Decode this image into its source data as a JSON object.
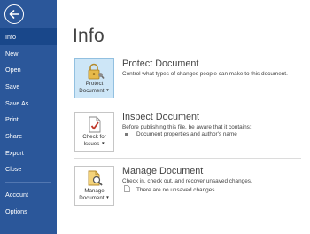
{
  "nav": {
    "items": [
      {
        "label": "Info",
        "selected": true
      },
      {
        "label": "New"
      },
      {
        "label": "Open"
      },
      {
        "label": "Save"
      },
      {
        "label": "Save As"
      },
      {
        "label": "Print"
      },
      {
        "label": "Share"
      },
      {
        "label": "Export"
      },
      {
        "label": "Close"
      },
      {
        "label": "Account"
      },
      {
        "label": "Options"
      }
    ]
  },
  "page": {
    "title": "Info"
  },
  "sections": {
    "protect": {
      "button_line1": "Protect",
      "button_line2": "Document",
      "title": "Protect Document",
      "description": "Control what types of changes people can make to this document."
    },
    "inspect": {
      "button_line1": "Check for",
      "button_line2": "Issues",
      "title": "Inspect Document",
      "description": "Before publishing this file, be aware that it contains:",
      "bullet": "Document properties and author's name"
    },
    "manage": {
      "button_line1": "Manage",
      "button_line2": "Document",
      "title": "Manage Document",
      "description": "Check in, check out, and recover unsaved changes.",
      "note": "There are no unsaved changes."
    }
  },
  "colors": {
    "nav_bg": "#2b579a",
    "nav_selected": "#19478a",
    "tile_active_bg": "#cde6f7"
  },
  "icons": {
    "back": "back-arrow-icon",
    "protect": "lock-key-icon",
    "inspect": "document-checkmark-icon",
    "manage": "document-magnifier-icon"
  }
}
